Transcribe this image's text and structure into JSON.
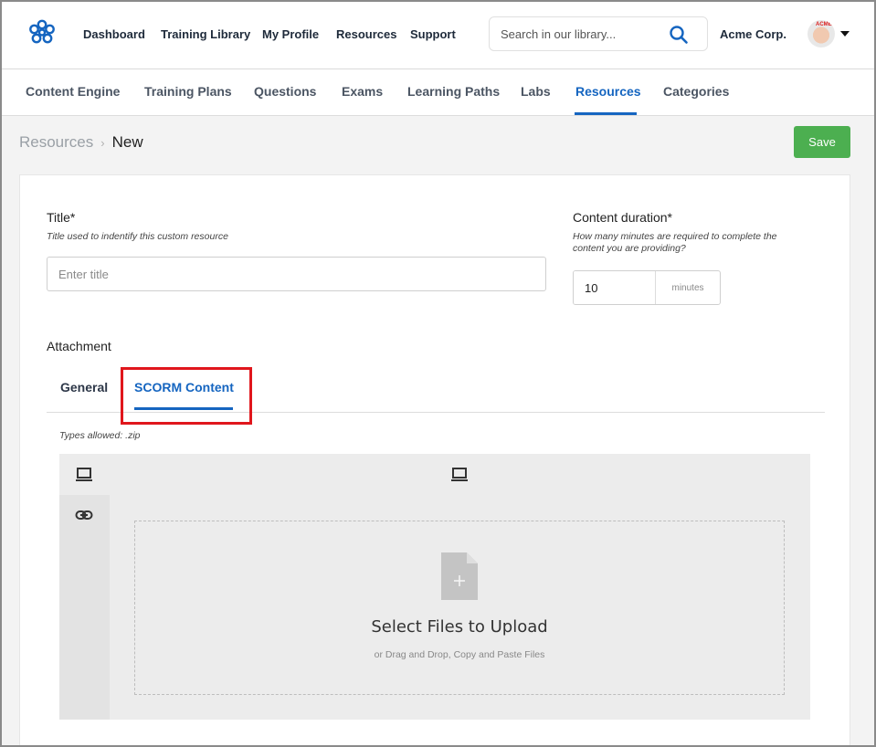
{
  "topnav": {
    "items": [
      "Dashboard",
      "Training Library",
      "My Profile",
      "Resources",
      "Support"
    ],
    "search_placeholder": "Search in our library...",
    "company": "Acme Corp.",
    "avatar_badge": "ACME"
  },
  "subnav": {
    "items": [
      "Content Engine",
      "Training Plans",
      "Questions",
      "Exams",
      "Learning Paths",
      "Labs",
      "Resources",
      "Categories"
    ],
    "active": "Resources"
  },
  "breadcrumb": {
    "root": "Resources",
    "separator": "›",
    "current": "New"
  },
  "actions": {
    "save_label": "Save"
  },
  "form": {
    "title": {
      "label": "Title*",
      "help": "Title used to indentify this custom resource",
      "placeholder": "Enter title"
    },
    "duration": {
      "label": "Content duration*",
      "help_line1": "How many minutes are required to complete the",
      "help_line2": "content you are providing?",
      "value": "10",
      "unit": "minutes"
    },
    "attachment": {
      "label": "Attachment",
      "tabs": [
        "General",
        "SCORM Content"
      ],
      "active_tab": "SCORM Content",
      "types_allowed": "Types allowed: .zip"
    }
  },
  "uploader": {
    "main_text": "Select Files to Upload",
    "sub_text": "or Drag and Drop, Copy and Paste Files"
  },
  "colors": {
    "accent": "#1565c0",
    "save": "#4caf50",
    "highlight": "#e0161c"
  }
}
